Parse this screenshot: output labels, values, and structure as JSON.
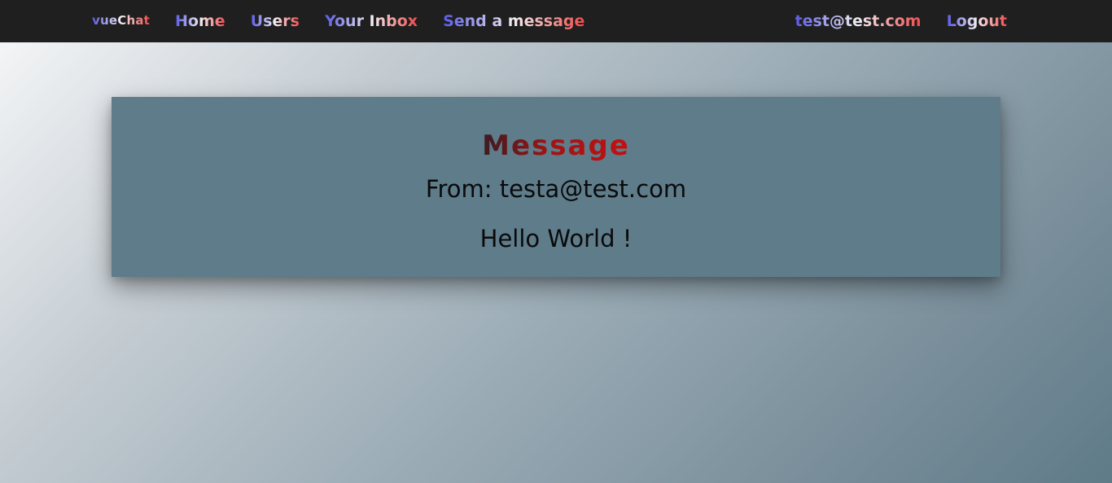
{
  "navbar": {
    "brand": "vueChat",
    "links": [
      "Home",
      "Users",
      "Your Inbox",
      "Send a message"
    ],
    "user_email": "test@test.com",
    "logout": "Logout"
  },
  "message": {
    "title": "Message",
    "from": "From: testa@test.com",
    "body": "Hello World !"
  },
  "colors": {
    "navbar_bg": "#1f1f1f",
    "card_bg": "#5f7c8a",
    "nav_gradient_start": "#5a5ae6",
    "nav_gradient_end": "#f04a4a",
    "title_red": "#c41010"
  }
}
